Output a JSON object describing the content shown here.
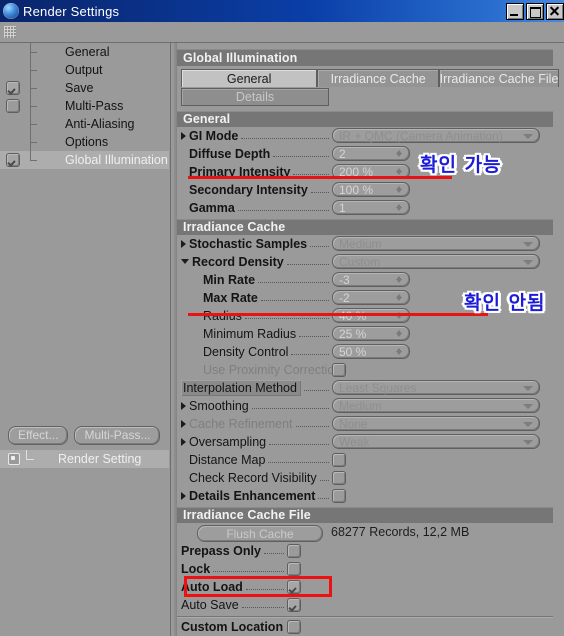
{
  "window": {
    "title": "Render Settings",
    "icon": "app-sphere-icon",
    "buttons": {
      "minimize": "minimize",
      "maximize": "maximize",
      "close": "close"
    }
  },
  "sidebar": {
    "items": [
      {
        "label": "General",
        "checkbox": "none",
        "selected": false
      },
      {
        "label": "Output",
        "checkbox": "none",
        "selected": false
      },
      {
        "label": "Save",
        "checkbox": "checked",
        "selected": false
      },
      {
        "label": "Multi-Pass",
        "checkbox": "empty",
        "selected": false
      },
      {
        "label": "Anti-Aliasing",
        "checkbox": "none",
        "selected": false
      },
      {
        "label": "Options",
        "checkbox": "none",
        "selected": false
      },
      {
        "label": "Global Illumination",
        "checkbox": "checked",
        "selected": true
      }
    ],
    "buttons": [
      {
        "label": "Effect..."
      },
      {
        "label": "Multi-Pass..."
      }
    ],
    "render_setting_row": {
      "label": "Render Setting"
    }
  },
  "panel": {
    "title": "Global Illumination",
    "tabs": [
      {
        "label": "General",
        "active": true
      },
      {
        "label": "Irradiance Cache",
        "active": false
      },
      {
        "label": "Irradiance Cache File",
        "active": false
      }
    ],
    "subtab": {
      "label": "Details"
    },
    "sections": {
      "general": {
        "title": "General",
        "rows": [
          {
            "label": "GI Mode",
            "bold": true,
            "expander": "right",
            "control": "combo",
            "value": "IR + QMC (Camera Animation)",
            "dim": true
          },
          {
            "label": "Diffuse Depth",
            "bold": true,
            "expander": "none",
            "control": "spin",
            "value": "2"
          },
          {
            "label": "Primary Intensity",
            "bold": true,
            "expander": "none",
            "control": "spin",
            "value": "200 %"
          },
          {
            "label": "Secondary Intensity",
            "bold": true,
            "expander": "none",
            "control": "spin",
            "value": "100 %"
          },
          {
            "label": "Gamma",
            "bold": true,
            "expander": "none",
            "control": "spin",
            "value": "1"
          }
        ]
      },
      "irradiance_cache": {
        "title": "Irradiance Cache",
        "rows": [
          {
            "label": "Stochastic Samples",
            "bold": true,
            "expander": "right",
            "control": "combo",
            "value": "Medium",
            "dim": true
          },
          {
            "label": "Record Density",
            "bold": true,
            "expander": "down",
            "control": "combo",
            "value": "Custom",
            "dim": true
          },
          {
            "label": "Min Rate",
            "bold": true,
            "expander": "none",
            "control": "spin",
            "value": "-3",
            "indent": 14
          },
          {
            "label": "Max Rate",
            "bold": true,
            "expander": "none",
            "control": "spin",
            "value": "-2",
            "indent": 14
          },
          {
            "label": "Radius",
            "bold": false,
            "expander": "none",
            "control": "spin",
            "value": "40 %",
            "indent": 14
          },
          {
            "label": "Minimum Radius",
            "bold": false,
            "expander": "none",
            "control": "spin",
            "value": "25 %",
            "indent": 14
          },
          {
            "label": "Density Control",
            "bold": false,
            "expander": "none",
            "control": "spin",
            "value": "50 %",
            "indent": 14
          },
          {
            "label": "Use Proximity Correction",
            "bold": false,
            "expander": "none",
            "control": "check",
            "value": "empty",
            "indent": 14,
            "disabled": true
          },
          {
            "label": "Interpolation Method",
            "bold": false,
            "expander": "none",
            "control": "combo",
            "value": "Least Squares",
            "dim": true,
            "highlight": true
          },
          {
            "label": "Smoothing",
            "bold": false,
            "expander": "right",
            "control": "combo",
            "value": "Medium",
            "dim": true
          },
          {
            "label": "Cache Refinement",
            "bold": false,
            "expander": "right",
            "control": "combo",
            "value": "None",
            "dim": true,
            "disabled": true
          },
          {
            "label": "Oversampling",
            "bold": false,
            "expander": "right",
            "control": "combo",
            "value": "Weak",
            "dim": true
          },
          {
            "label": "Distance Map",
            "bold": false,
            "expander": "none",
            "control": "check",
            "value": "empty"
          },
          {
            "label": "Check Record Visibility",
            "bold": false,
            "expander": "none",
            "control": "check",
            "value": "empty"
          },
          {
            "label": "Details Enhancement",
            "bold": true,
            "expander": "right",
            "control": "check",
            "value": "empty"
          }
        ]
      },
      "irradiance_cache_file": {
        "title": "Irradiance Cache File",
        "flush_button": "Flush Cache",
        "records_text": "68277 Records, 12,2 MB",
        "rows": [
          {
            "label": "Prepass Only",
            "bold": true,
            "control": "check",
            "value": "empty"
          },
          {
            "label": "Lock",
            "bold": true,
            "control": "check",
            "value": "empty"
          },
          {
            "label": "Auto Load",
            "bold": true,
            "control": "check",
            "value": "checked"
          },
          {
            "label": "Auto Save",
            "bold": false,
            "control": "check",
            "value": "checked"
          },
          {
            "label": "Custom Location",
            "bold": true,
            "control": "check",
            "value": "empty"
          }
        ]
      }
    }
  },
  "annotations": {
    "note_primary_intensity": {
      "text": "확인 가능",
      "color": "#1b1bd8"
    },
    "note_max_rate": {
      "text": "확인 안됨",
      "color": "#1b1bd8"
    },
    "underline_color": "#e81313",
    "highlight_box_color": "#ee1111",
    "highlight_box_target": "Auto Load"
  }
}
